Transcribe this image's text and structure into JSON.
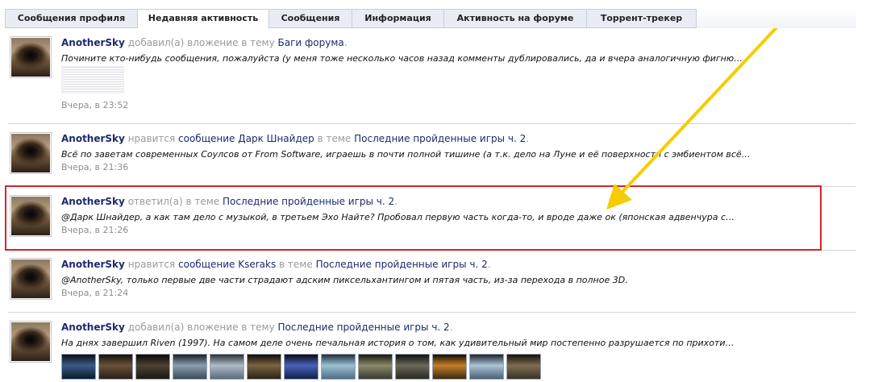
{
  "tabs": [
    {
      "label": "Сообщения профиля"
    },
    {
      "label": "Недавняя активность"
    },
    {
      "label": "Сообщения"
    },
    {
      "label": "Информация"
    },
    {
      "label": "Активность на форуме"
    },
    {
      "label": "Торрент-трекер"
    }
  ],
  "active_tab": "Недавняя активность",
  "entries": [
    {
      "user": "AnotherSky",
      "action": "добавил(а) вложение в тему",
      "topic": "Баги форума",
      "suffix": ".",
      "snippet": "Почините кто-нибудь сообщения, пожалуйста (у меня тоже несколько часов назад комменты дублировались, да и вчера аналогичную фигню…",
      "time": "Вчера, в 23:52"
    },
    {
      "user": "AnotherSky",
      "action": "нравится",
      "object": "сообщение Дарк Шнайдер",
      "mid": "в теме",
      "topic": "Последние пройденные игры ч. 2",
      "suffix": ".",
      "snippet": "Всё по заветам современных Соулсов от From Software, играешь в почти полной тишине (а т.к. дело на Луне и её поверхности с эмбиентом всё…",
      "time": "Вчера, в 21:36"
    },
    {
      "user": "AnotherSky",
      "action": "ответил(а) в теме",
      "topic": "Последние пройденные игры ч. 2",
      "suffix": ".",
      "snippet": "@Дарк Шнайдер, а как там дело с музыкой, в третьем Эхо Найте? Пробовал первую часть когда-то, и вроде даже ок (японская адвенчура с…",
      "time": "Вчера, в 21:26"
    },
    {
      "user": "AnotherSky",
      "action": "нравится",
      "object": "сообщение Kseraks",
      "mid": "в теме",
      "topic": "Последние пройденные игры ч. 2",
      "suffix": ".",
      "snippet": "@AnotherSky, только первые две части страдают адским пиксельхантингом и пятая часть, из-за перехода в полное 3D.",
      "time": "Вчера, в 21:24"
    },
    {
      "user": "AnotherSky",
      "action": "добавил(а) вложение в тему",
      "topic": "Последние пройденные игры ч. 2",
      "suffix": ".",
      "snippet": "На днях завершил Riven (1997). На самом деле очень печальная история о том, как удивительный мир постепенно разрушается по прихоти…"
    }
  ],
  "colors": {
    "highlight_border": "#d8232a",
    "arrow": "#f5cd00",
    "link": "#1c2a6e"
  },
  "thumbnail_count": 13
}
